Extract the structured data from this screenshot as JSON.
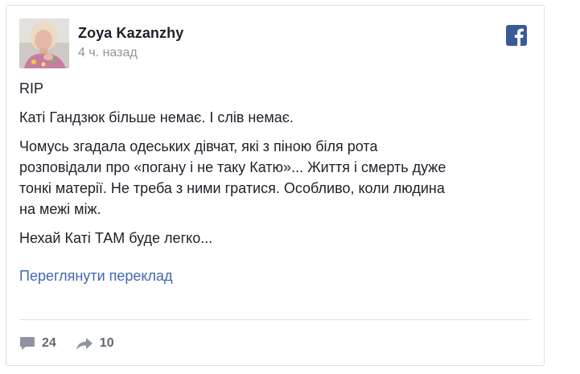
{
  "post": {
    "author": "Zoya Kazanzhy",
    "time": "4 ч. назад",
    "paragraphs": [
      "RIP",
      "Каті Гандзюк більше немає. І слів немає.",
      "Чомусь згадала одеських дівчат, які з піною біля рота\nрозповідали про «погану і не таку Катю»... Життя і смерть дуже\nтонкі матерії. Не треба з ними гратися. Особливо, коли людина\nна межі між.",
      "Нехай Каті ТАМ буде легко..."
    ],
    "translate_link": "Переглянути переклад"
  },
  "stats": {
    "comments": "24",
    "shares": "10"
  },
  "icons": {
    "brand": "facebook-icon",
    "comments": "comment-icon",
    "shares": "share-icon"
  },
  "colors": {
    "brand": "#3b5998",
    "link": "#4267b2",
    "meta": "#90949c",
    "stat": "#616770"
  }
}
